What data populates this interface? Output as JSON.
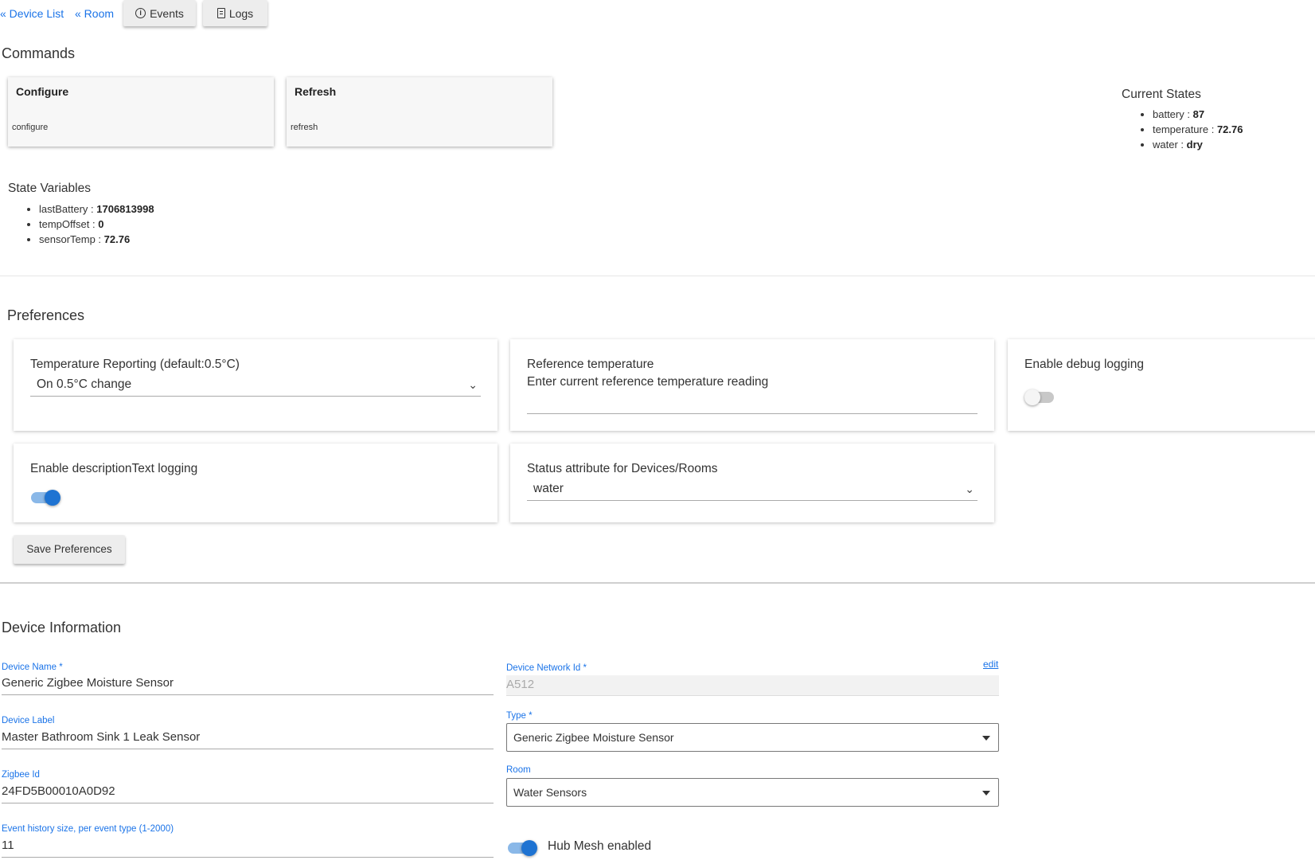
{
  "nav": {
    "device_list": "« Device List",
    "room": "« Room",
    "events": "Events",
    "logs": "Logs"
  },
  "commands": {
    "heading": "Commands",
    "cards": [
      {
        "title": "Configure",
        "command": "configure"
      },
      {
        "title": "Refresh",
        "command": "refresh"
      }
    ]
  },
  "current_states": {
    "heading": "Current States",
    "items": [
      {
        "key": "battery",
        "value": "87"
      },
      {
        "key": "temperature",
        "value": "72.76"
      },
      {
        "key": "water",
        "value": "dry"
      }
    ]
  },
  "state_variables": {
    "heading": "State Variables",
    "items": [
      {
        "key": "lastBattery",
        "value": "1706813998"
      },
      {
        "key": "tempOffset",
        "value": "0"
      },
      {
        "key": "sensorTemp",
        "value": "72.76"
      }
    ]
  },
  "preferences": {
    "heading": "Preferences",
    "temp_reporting": {
      "label": "Temperature Reporting (default:0.5°C)",
      "value": "On 0.5°C change"
    },
    "reference_temp": {
      "label": "Reference temperature",
      "sublabel": "Enter current reference temperature reading",
      "value": ""
    },
    "debug_logging": {
      "label": "Enable debug logging",
      "enabled": false
    },
    "desc_logging": {
      "label": "Enable descriptionText logging",
      "enabled": true
    },
    "status_attribute": {
      "label": "Status attribute for Devices/Rooms",
      "value": "water"
    },
    "save_label": "Save Preferences"
  },
  "device_info": {
    "heading": "Device Information",
    "device_name": {
      "label": "Device Name *",
      "value": "Generic Zigbee Moisture Sensor"
    },
    "device_label": {
      "label": "Device Label",
      "value": "Master Bathroom Sink 1 Leak Sensor"
    },
    "zigbee_id": {
      "label": "Zigbee Id",
      "value": "24FD5B00010A0D92"
    },
    "event_history": {
      "label": "Event history size, per event type (1-2000)",
      "value": "11"
    },
    "network_id": {
      "label": "Device Network Id *",
      "value": "A512",
      "edit_label": "edit"
    },
    "type": {
      "label": "Type *",
      "value": "Generic Zigbee Moisture Sensor"
    },
    "room": {
      "label": "Room",
      "value": "Water Sensors"
    },
    "hub_mesh": {
      "label": "Hub Mesh enabled",
      "enabled": true
    }
  },
  "colors": {
    "accent": "#1a73e8",
    "switch_on": "#1e73d2"
  }
}
